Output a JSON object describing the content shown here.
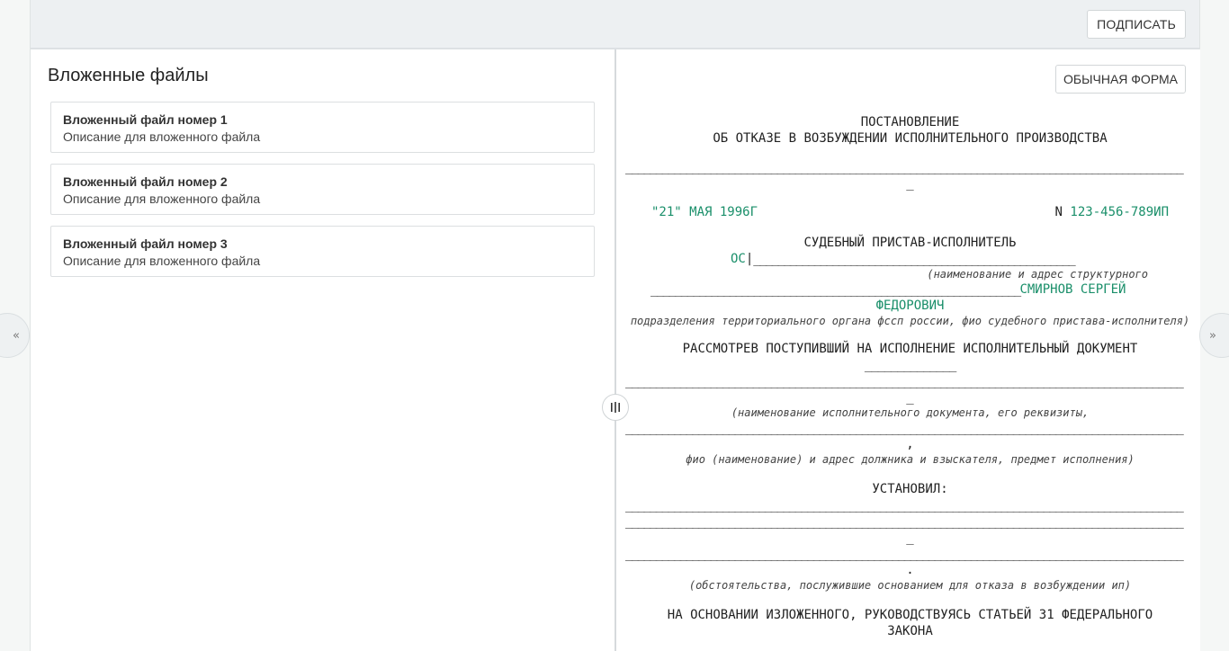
{
  "toolbar": {
    "sign_label": "ПОДПИСАТЬ"
  },
  "attachments": {
    "title": "Вложенные файлы",
    "items": [
      {
        "name": "Вложенный файл номер 1",
        "description": "Описание для вложенного файла"
      },
      {
        "name": "Вложенный файл номер 2",
        "description": "Описание для вложенного файла"
      },
      {
        "name": "Вложенный файл номер 3",
        "description": "Описание для вложенного файла"
      }
    ]
  },
  "viewer": {
    "form_button_label": "ОБЫЧНАЯ ФОРМА"
  },
  "nav": {
    "prev_icon": "«",
    "next_icon": "»"
  },
  "document": {
    "title_line1": "ПОСТАНОВЛЕНИЕ",
    "title_line2": "ОБ ОТКАЗЕ В ВОЗБУЖДЕНИИ ИСПОЛНИТЕЛЬНОГО ПРОИЗВОДСТВА",
    "underline_tail": "_",
    "date_quoted": "\"21\"",
    "date_rest": "МАЯ 1996Г",
    "number_prefix": "N",
    "number_value": "123-456-789ИП",
    "bailiff_heading": "СУДЕБНЫЙ ПРИСТАВ-ИСПОЛНИТЕЛЬ",
    "department_value": "ОС",
    "department_cursor": "|",
    "department_note": "(наименование и адрес структурного",
    "bailiff_name_line1": "СМИРНОВ СЕРГЕЙ",
    "bailiff_name_line2": "ФЕДОРОВИЧ",
    "bailiff_note": "подразделения территориального органа фссп россии, фио судебного пристава-исполнителя)",
    "review_text": "РАССМОТРЕВ ПОСТУПИВШИЙ НА ИСПОЛНЕНИЕ ИСПОЛНИТЕЛЬНЫЙ ДОКУМЕНТ",
    "exec_doc_note": "(наименование исполнительного документа, его реквизиты,",
    "comma_tail": ",",
    "debtor_note": "фио (наименование) и адрес должника и взыскателя, предмет исполнения)",
    "established": "УСТАНОВИЛ:",
    "period_tail": ".",
    "circumstances_note": "(обстоятельства, послужившие основанием для отказа в возбуждении ип)",
    "basis_line1": "НА ОСНОВАНИИ ИЗЛОЖЕННОГО, РУКОВОДСТВУЯСЬ СТАТЬЕЙ 31 ФЕДЕРАЛЬНОГО",
    "basis_line2": "ЗАКОНА"
  }
}
